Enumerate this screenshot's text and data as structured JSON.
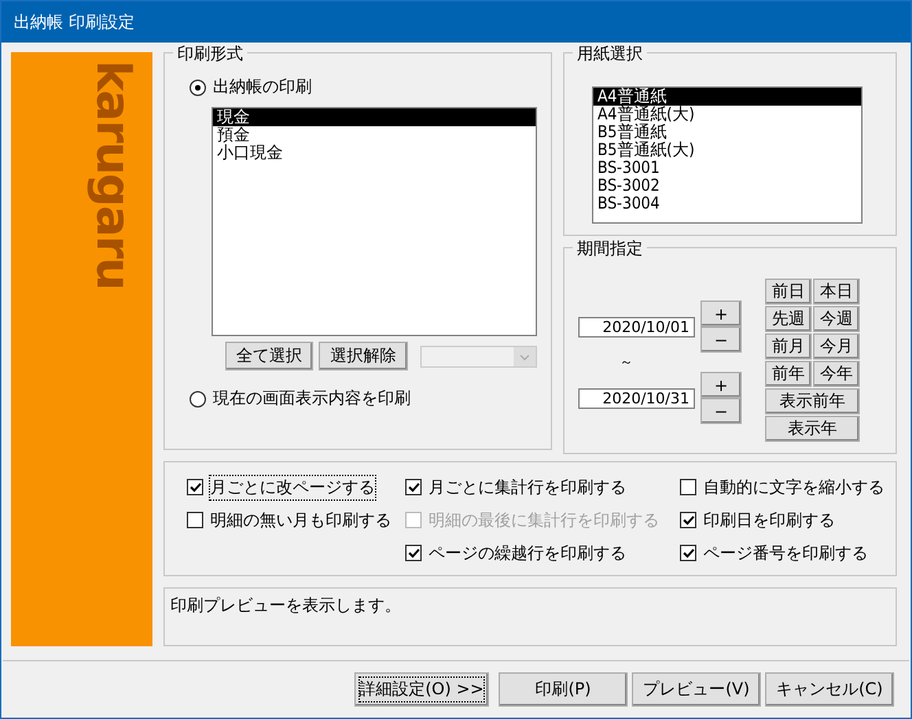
{
  "window": {
    "title": "出納帳 印刷設定"
  },
  "logo": {
    "text": "karugaru"
  },
  "print_format": {
    "title": "印刷形式",
    "radios": [
      {
        "label": "出納帳の印刷",
        "selected": true
      },
      {
        "label": "現在の画面表示内容を印刷",
        "selected": false
      }
    ],
    "accounts": [
      {
        "label": "現金",
        "selected": true
      },
      {
        "label": "預金",
        "selected": false
      },
      {
        "label": "小口現金",
        "selected": false
      }
    ],
    "buttons": [
      "全て選択",
      "選択解除"
    ],
    "dropdown": {
      "disabled": true
    }
  },
  "paper": {
    "title": "用紙選択",
    "items": [
      {
        "label": "A4普通紙",
        "selected": true
      },
      {
        "label": "A4普通紙(大)",
        "selected": false
      },
      {
        "label": "B5普通紙",
        "selected": false
      },
      {
        "label": "B5普通紙(大)",
        "selected": false
      },
      {
        "label": "BS-3001",
        "selected": false
      },
      {
        "label": "BS-3002",
        "selected": false
      },
      {
        "label": "BS-3004",
        "selected": false
      }
    ]
  },
  "period": {
    "title": "期間指定",
    "from": "2020/10/01",
    "separator": "～",
    "to": "2020/10/31",
    "plus": "+",
    "minus": "−",
    "quick": [
      "前日",
      "本日",
      "先週",
      "今週",
      "前月",
      "今月",
      "前年",
      "今年"
    ],
    "wide": [
      "表示前年",
      "表示年"
    ]
  },
  "options": [
    [
      {
        "label": "月ごとに改ページする",
        "checked": true,
        "disabled": false,
        "focused": true
      },
      {
        "label": "明細の無い月も印刷する",
        "checked": false,
        "disabled": false,
        "focused": false
      }
    ],
    [
      {
        "label": "月ごとに集計行を印刷する",
        "checked": true,
        "disabled": false,
        "focused": false
      },
      {
        "label": "明細の最後に集計行を印刷する",
        "checked": false,
        "disabled": true,
        "focused": false
      },
      {
        "label": "ページの繰越行を印刷する",
        "checked": true,
        "disabled": false,
        "focused": false
      }
    ],
    [
      {
        "label": "自動的に文字を縮小する",
        "checked": false,
        "disabled": false,
        "focused": false
      },
      {
        "label": "印刷日を印刷する",
        "checked": true,
        "disabled": false,
        "focused": false
      },
      {
        "label": "ページ番号を印刷する",
        "checked": true,
        "disabled": false,
        "focused": false
      }
    ]
  ],
  "message": "印刷プレビューを表示します。",
  "buttons": [
    {
      "label": "詳細設定(O) >>",
      "focused": true
    },
    {
      "label": "印刷(P)",
      "focused": false
    },
    {
      "label": "プレビュー(V)",
      "focused": false
    },
    {
      "label": "キャンセル(C)",
      "focused": false
    }
  ]
}
